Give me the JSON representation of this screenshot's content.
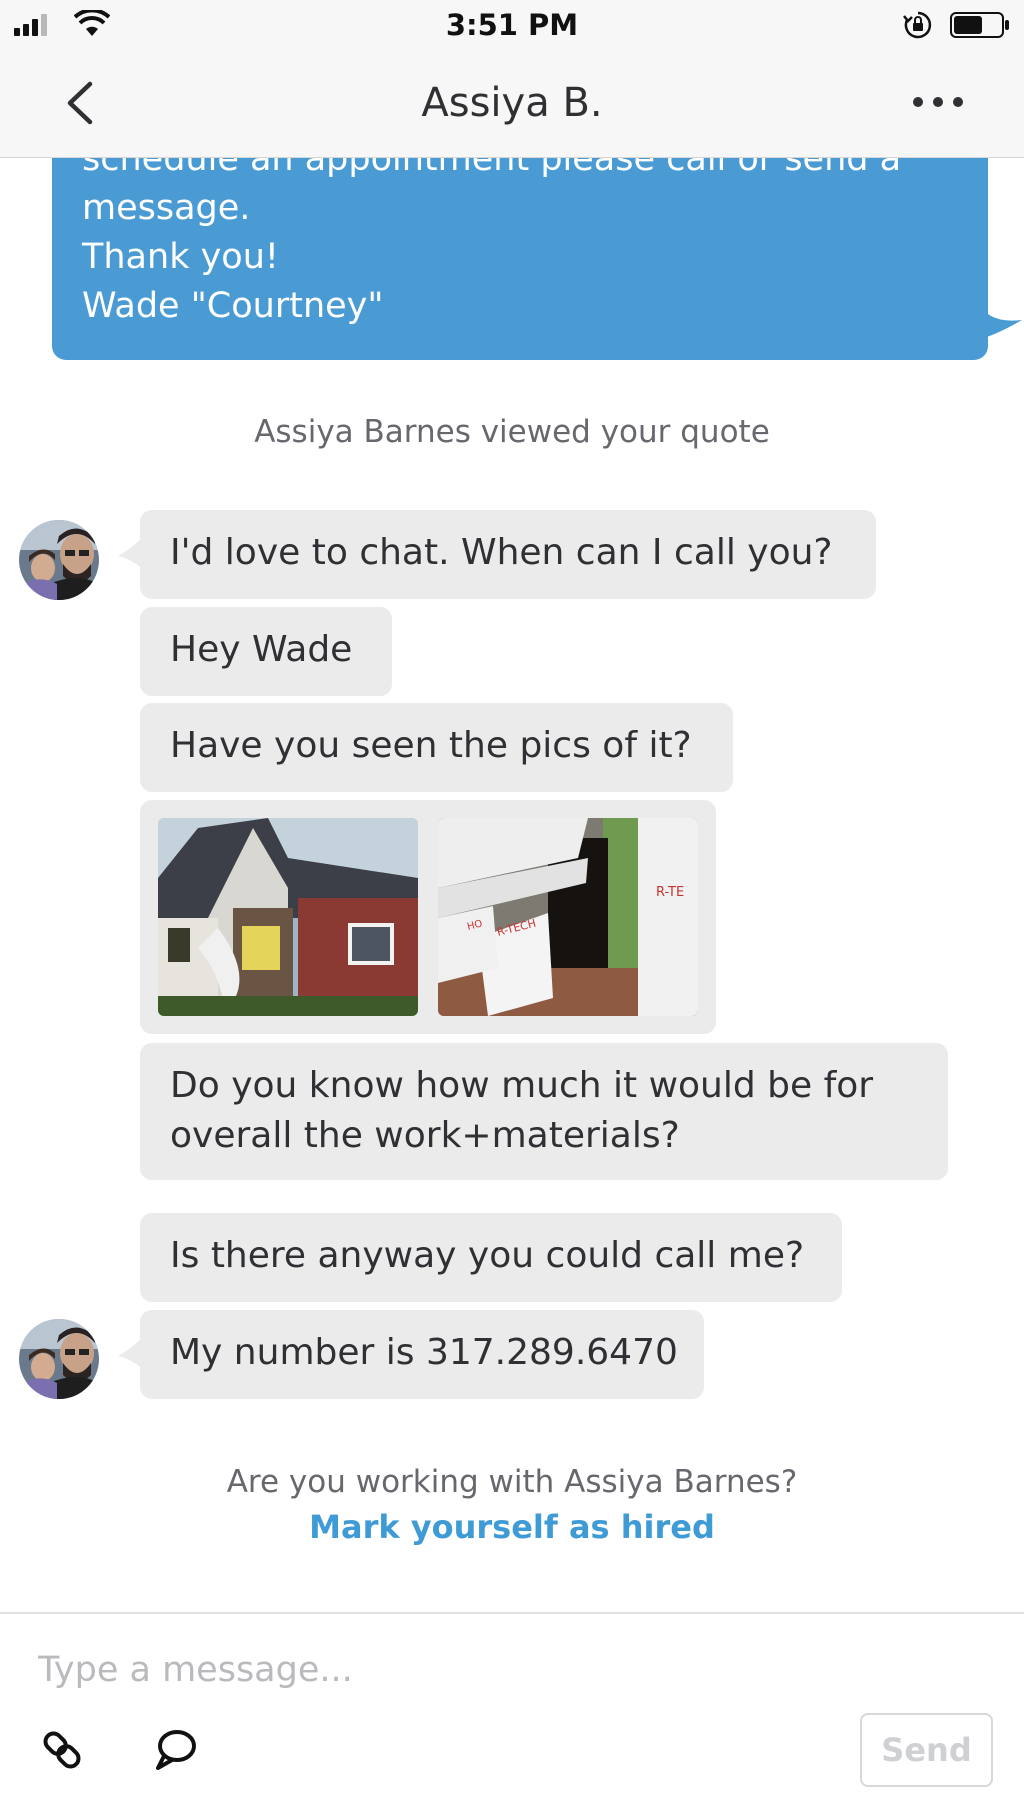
{
  "status_bar": {
    "time": "3:51 PM"
  },
  "header": {
    "title": "Assiya B."
  },
  "outgoing_message": {
    "lines": [
      "schedule an appointment please call or send a",
      "message.",
      "Thank you!",
      "Wade \"Courtney\""
    ],
    "color": "#4a9bd4"
  },
  "system_note": "Assiya Barnes viewed your quote",
  "incoming_messages": [
    "I'd love to chat. When can I call you?",
    "Hey Wade",
    "Have you seen the pics of it?",
    [
      "Do you know how much it would be for",
      "overall the work+materials?"
    ],
    "Is there anyway you could call me?",
    "My number is 317.289.6470"
  ],
  "photos": [
    "house-damage-photo",
    "siding-damage-photo"
  ],
  "hire_prompt": {
    "question": "Are you working with Assiya Barnes?",
    "link": "Mark yourself as hired",
    "link_color": "#3f9bd5"
  },
  "composer": {
    "placeholder": "Type a message...",
    "value": "",
    "send_label": "Send"
  }
}
